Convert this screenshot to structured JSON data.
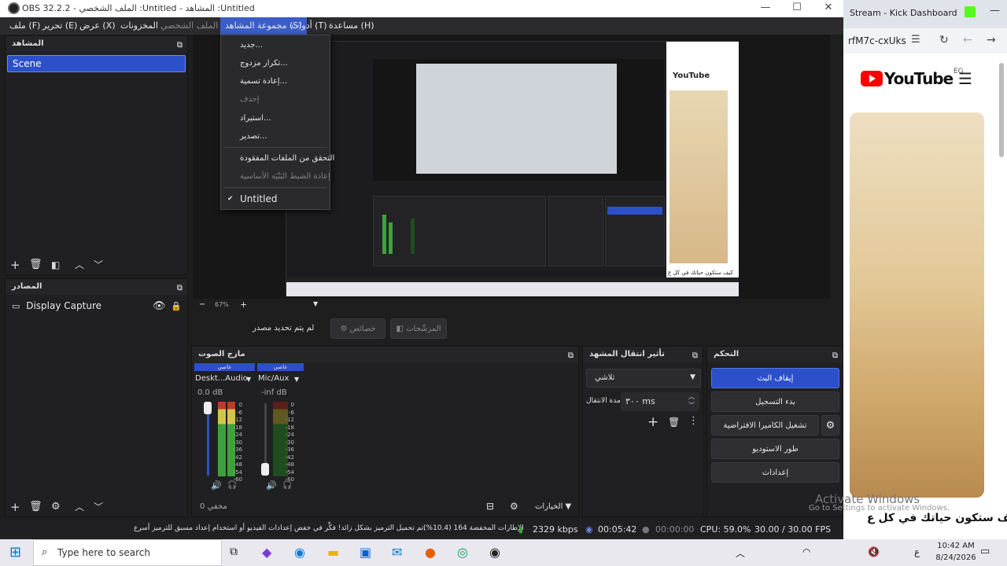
{
  "window": {
    "title": "OBS 32.2.2 - الملف الشخصي :Untitled - المشاهد :Untitled",
    "min": "—",
    "max": "☐",
    "close": "✕"
  },
  "menu": {
    "file": "ملف (F)",
    "edit": "تحرير (E)",
    "view": "عرض (X)",
    "docks": "المخزونات",
    "profile": "الملف الشخصي (P)",
    "scene_collection": "مجموعة المشاهد (S)",
    "tools": "أدوات (T)",
    "help": "مساعدة (H)"
  },
  "dropdown": {
    "new": "جديد...",
    "duplicate": "تكرار مزدوج...",
    "rename": "إعادة تسمية...",
    "remove": "إحذف",
    "import": "استيراد...",
    "export": "تصدير...",
    "check_missing": "التحقق من الملفات المفقودة",
    "reset": "إعادة الضبط البَنْيَة الأساسية",
    "current": "Untitled",
    "check": "✔"
  },
  "scenes": {
    "title": "المشاهد",
    "items": [
      "Scene"
    ]
  },
  "sources": {
    "title": "المصادر",
    "items": [
      {
        "label": "Display Capture"
      }
    ]
  },
  "preview": {
    "zoom": "67%",
    "no_source": "لم يتم تحديد مصدر",
    "properties": "خصائص",
    "filters": "المرشّحات",
    "youtube_title": "كيف ستكون حياتك في كل ع",
    "inner_youtube": "YouTube"
  },
  "audio_mixer": {
    "title": "مازج الصوت",
    "channels": [
      {
        "badge": "عاصي",
        "name": "Deskt...Audio",
        "level": "0.0 dB",
        "level_fraction": 0.9
      },
      {
        "badge": "عاصي",
        "name": "Mic/Aux",
        "level": "-inf dB",
        "level_fraction": 0.0
      }
    ],
    "ticks": [
      "0",
      "-6",
      "-12",
      "-18",
      "-24",
      "-30",
      "-36",
      "-42",
      "-48",
      "-54",
      "-60"
    ],
    "hidden_count": "مخفي 0",
    "options": "الخيارات"
  },
  "transitions": {
    "title": "تأثير انتقال المشهد",
    "type": "تلاشي",
    "duration_label": "مدة الانتقال",
    "duration": "٣٠٠ ms"
  },
  "controls": {
    "title": "التحكم",
    "stop_stream": "إيقاف البث",
    "start_record": "بدء التسجيل",
    "virtual_cam": "تشغيل الكاميرا الافتراضية",
    "studio_mode": "طور الاستوديو",
    "settings": "إعدادات"
  },
  "status": {
    "warning": "تم تحميل الترميز بشكل زائد! فكِّر في خفض إعدادات الفيديو أو استخدام إعداد مسبق للترميز أسرع.",
    "dropped": "الإطارات المخفضة 164 (10.4%)",
    "bitrate": "2329 kbps",
    "stream_time": "00:05:42",
    "rec_time": "00:00:00",
    "cpu": "CPU: 59.0%",
    "fps": "30.00 / 30.00 FPS"
  },
  "browser": {
    "tab": "Stream - Kick Dashboard",
    "url": "rfM7c-cxUks",
    "yt_logo": "YouTube",
    "yt_region": "EG",
    "video_title": "كيف ستكون حياتك في كل ع",
    "watermark_1": "Activate Windows",
    "watermark_2": "Go to Settings to activate Windows."
  },
  "taskbar": {
    "search": "Type here to search",
    "time": "10:42 AM",
    "date": "8/24/2026",
    "lang": "ع"
  },
  "colors": {
    "accent": "#2c50c9",
    "panel": "#202022"
  }
}
